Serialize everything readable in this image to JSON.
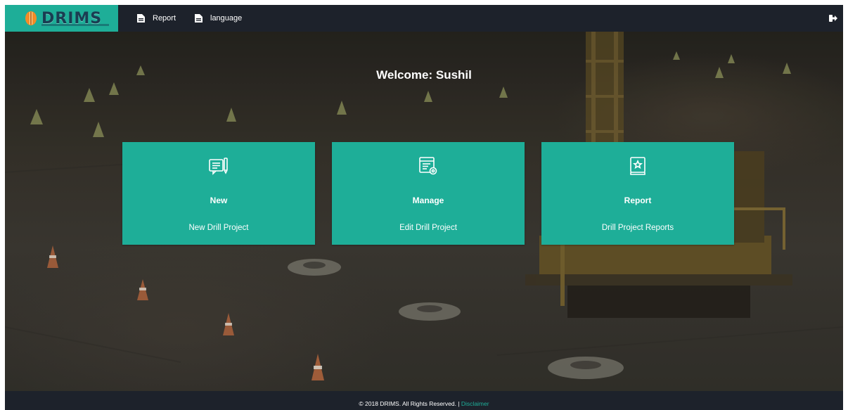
{
  "brand": {
    "name": "DRIMS"
  },
  "nav": {
    "items": [
      {
        "label": "Report",
        "icon": "file-icon"
      },
      {
        "label": "language",
        "icon": "file-icon"
      }
    ],
    "logout_icon": "sign-out-icon"
  },
  "welcome": {
    "text": "Welcome: Sushil"
  },
  "cards": [
    {
      "title": "New",
      "subtitle": "New Drill Project",
      "icon": "edit-document-icon"
    },
    {
      "title": "Manage",
      "subtitle": "Edit Drill Project",
      "icon": "settings-document-icon"
    },
    {
      "title": "Report",
      "subtitle": "Drill Project Reports",
      "icon": "report-book-icon"
    }
  ],
  "footer": {
    "copyright": "© 2018 DRIMS. All Rights Reserved. |",
    "link": "Disclaimer"
  },
  "colors": {
    "accent": "#1eae98",
    "bar": "#1d222b"
  }
}
